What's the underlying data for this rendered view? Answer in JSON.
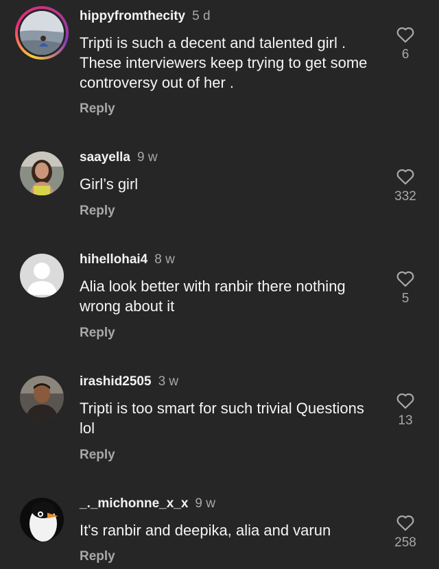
{
  "comments": [
    {
      "username": "hippyfromthecity",
      "time": "5 d",
      "text": "Tripti is such a decent and talented girl . These interviewers keep trying to get some controversy out of her .",
      "reply_label": "Reply",
      "likes": "6"
    },
    {
      "username": "saayella",
      "time": "9 w",
      "text": "Girl’s girl",
      "reply_label": "Reply",
      "likes": "332"
    },
    {
      "username": "hihellohai4",
      "time": "8 w",
      "text": "Alia look better with ranbir there nothing wrong about it",
      "reply_label": "Reply",
      "likes": "5"
    },
    {
      "username": "irashid2505",
      "time": "3 w",
      "text": "Tripti is too smart for such trivial Questions lol",
      "reply_label": "Reply",
      "likes": "13"
    },
    {
      "username": "_._michonne_x_x",
      "time": "9 w",
      "text": "It's ranbir and deepika, alia and varun",
      "reply_label": "Reply",
      "likes": "258"
    }
  ],
  "icons": {
    "like": "heart-outline-icon"
  },
  "colors": {
    "background": "#262626",
    "primary_text": "#f5f5f5",
    "secondary_text": "#a8a8a8",
    "story_ring": [
      "#f9ce34",
      "#ee2a7b",
      "#8a3ab9"
    ]
  }
}
